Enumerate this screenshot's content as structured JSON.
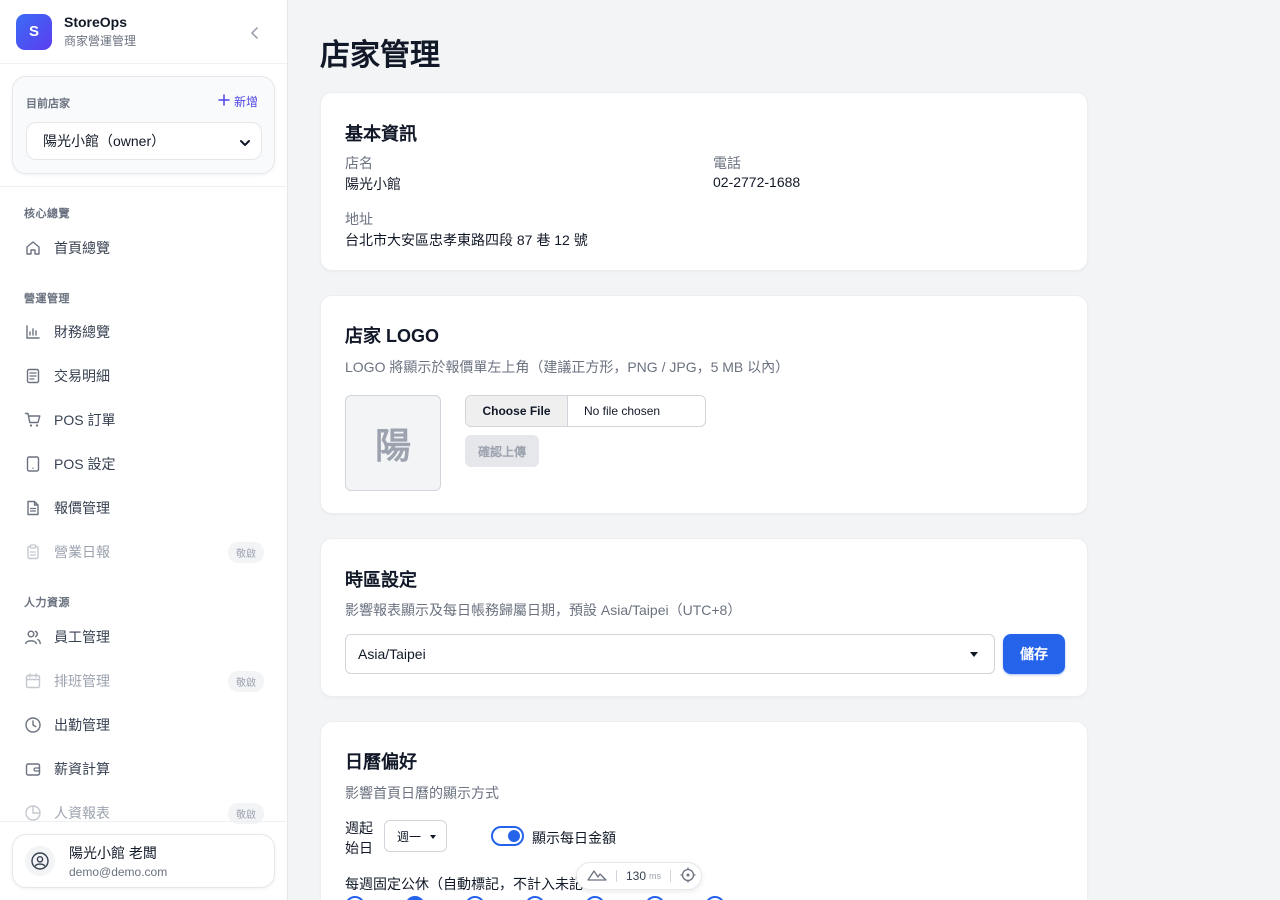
{
  "app": {
    "name": "StoreOps",
    "subtitle": "商家營運管理",
    "logo_letter": "S"
  },
  "store_switcher": {
    "label": "目前店家",
    "add_label": "新增",
    "selected": "陽光小館（owner）"
  },
  "nav": {
    "sections": [
      {
        "title": "核心總覽",
        "items": [
          {
            "label": "首頁總覽",
            "icon": "home-icon"
          }
        ]
      },
      {
        "title": "營運管理",
        "items": [
          {
            "label": "財務總覽",
            "icon": "bar-chart-icon"
          },
          {
            "label": "交易明細",
            "icon": "document-icon"
          },
          {
            "label": "POS 訂單",
            "icon": "cart-icon"
          },
          {
            "label": "POS 設定",
            "icon": "tablet-icon"
          },
          {
            "label": "報價管理",
            "icon": "file-icon"
          },
          {
            "label": "營業日報",
            "icon": "clipboard-icon",
            "badge": "敬啟"
          }
        ]
      },
      {
        "title": "人力資源",
        "items": [
          {
            "label": "員工管理",
            "icon": "users-icon"
          },
          {
            "label": "排班管理",
            "icon": "calendar-icon",
            "badge": "敬啟"
          },
          {
            "label": "出勤管理",
            "icon": "clock-icon"
          },
          {
            "label": "薪資計算",
            "icon": "wallet-icon"
          },
          {
            "label": "人資報表",
            "icon": "pie-chart-icon",
            "badge": "敬啟"
          }
        ]
      }
    ]
  },
  "user": {
    "name": "陽光小館 老闆",
    "email": "demo@demo.com"
  },
  "page": {
    "title": "店家管理"
  },
  "basic_info": {
    "title": "基本資訊",
    "store_name_label": "店名",
    "store_name": "陽光小館",
    "phone_label": "電話",
    "phone": "02-2772-1688",
    "address_label": "地址",
    "address": "台北市大安區忠孝東路四段 87 巷 12 號"
  },
  "logo_section": {
    "title": "店家 LOGO",
    "description": "LOGO 將顯示於報價單左上角（建議正方形，PNG / JPG，5 MB 以內）",
    "placeholder_char": "陽",
    "choose_file_label": "Choose File",
    "file_status": "No file chosen",
    "upload_label": "確認上傳"
  },
  "timezone_section": {
    "title": "時區設定",
    "description": "影響報表顯示及每日帳務歸屬日期，預設 Asia/Taipei（UTC+8）",
    "selected": "Asia/Taipei",
    "save_label": "儲存"
  },
  "calendar_section": {
    "title": "日曆偏好",
    "description": "影響首頁日曆的顯示方式",
    "week_start_label": "週起始日",
    "week_start_value": "週一",
    "show_daily_amount_label": "顯示每日金額",
    "show_daily_amount": true,
    "holiday_label": "每週固定公休（自動標記，不計入未記",
    "day_checks": [
      false,
      true,
      false,
      false,
      false,
      false,
      false
    ]
  },
  "perf_widget": {
    "value": "130",
    "unit": "ms"
  },
  "colors": {
    "accent": "#2563eb",
    "brand_gradient_start": "#3b6cf5",
    "brand_gradient_end": "#5b3df0"
  }
}
